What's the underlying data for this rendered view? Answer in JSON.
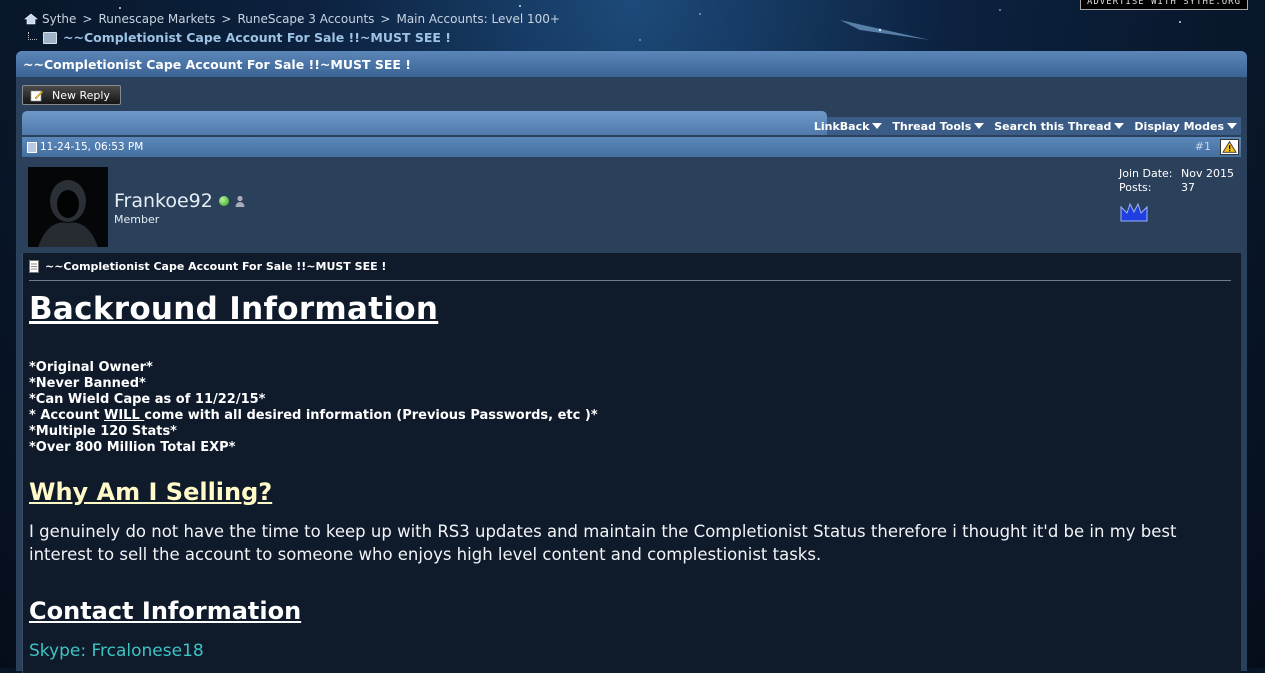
{
  "advertise_label": "ADVERTISE WITH SYTHE.ORG",
  "breadcrumb": {
    "items": [
      "Sythe",
      "Runescape Markets",
      "RuneScape 3 Accounts",
      "Main Accounts: Level 100+"
    ],
    "separator": ">",
    "current": "~~Completionist Cape Account For Sale !!~MUST SEE !"
  },
  "thread": {
    "title": "~~Completionist Cape Account For Sale !!~MUST SEE !",
    "new_reply_label": "New Reply",
    "tools": [
      "LinkBack",
      "Thread Tools",
      "Search this Thread",
      "Display Modes"
    ]
  },
  "post": {
    "date": "11-24-15, 06:53 PM",
    "number": "#1",
    "user": {
      "name": "Frankoe92",
      "title": "Member",
      "join_date_label": "Join Date:",
      "join_date": "Nov 2015",
      "posts_label": "Posts:",
      "posts": "37"
    },
    "title": "~~Completionist Cape Account For Sale !!~MUST SEE !",
    "heading1": "Backround Information",
    "list": [
      "*Original Owner*",
      "*Never Banned*",
      "*Can Wield Cape as of 11/22/15*"
    ],
    "list_line4_pre": "* Account ",
    "list_line4_underlined": "WILL ",
    "list_line4_post": "come with all desired information (Previous Passwords, etc )*",
    "list_tail": [
      "*Multiple 120 Stats*",
      "*Over 800 Million Total EXP*"
    ],
    "heading2": "Why Am I Selling?",
    "paragraph": "I genuinely do not have the time to keep up with RS3 updates and maintain the Completionist Status therefore i thought it'd be in my best interest to sell the account to someone who enjoys high level content and complestionist tasks.",
    "heading3": "Contact Information",
    "skype": "Skype: Frcalonese18"
  },
  "colors": {
    "title_bar": "#4a74a6",
    "panel": "#2b405a",
    "post_body": "#0f1a2a",
    "heading2": "#fffac8",
    "skype": "#3dc4c4"
  }
}
